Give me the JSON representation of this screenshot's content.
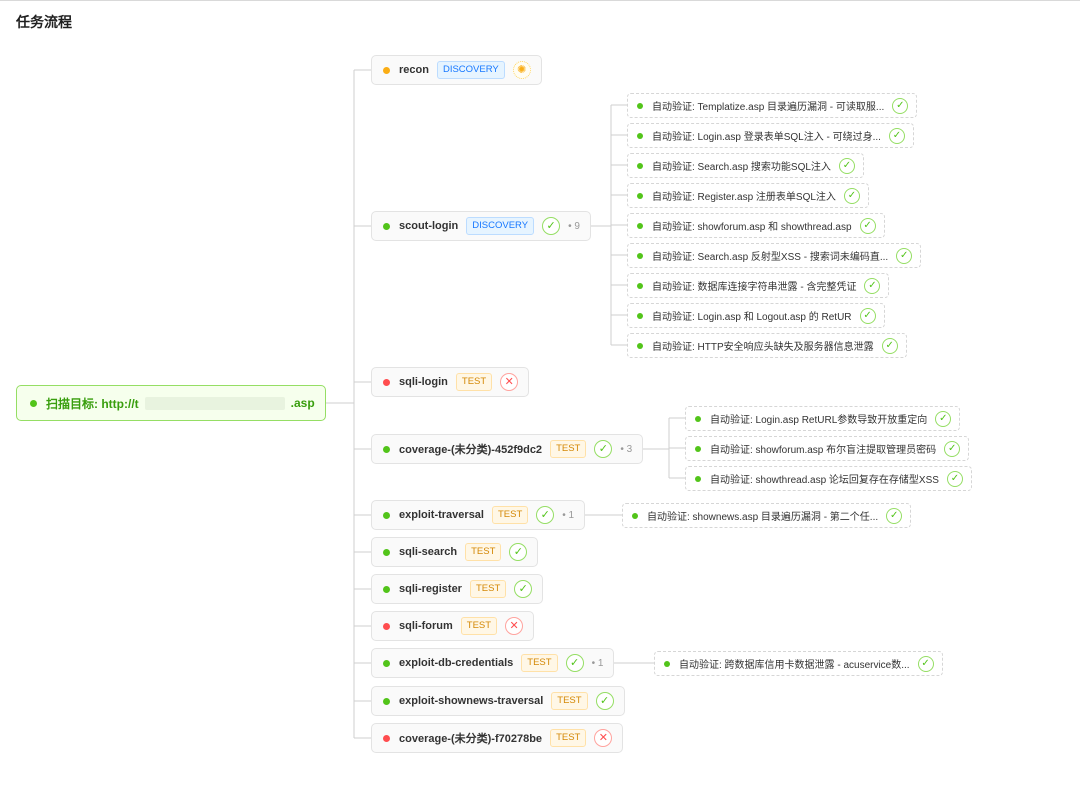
{
  "page": {
    "title": "任务流程"
  },
  "colors": {
    "success": "#52c41a",
    "failed": "#ff4d4f",
    "running": "#faad14",
    "discovery_tag": "#1677ff",
    "test_tag": "#d48806",
    "root_text": "#389e0d"
  },
  "root": {
    "prefix": "扫描目标: http://t",
    "suffix": ".asp",
    "status": "success"
  },
  "tasks": [
    {
      "name": "recon",
      "tag": "DISCOVERY",
      "status": "running",
      "status_icon": "loading-icon",
      "count": ""
    },
    {
      "name": "scout-login",
      "tag": "DISCOVERY",
      "status": "success",
      "status_icon": "check-icon",
      "count": "9"
    },
    {
      "name": "sqli-login",
      "tag": "TEST",
      "status": "failed",
      "status_icon": "close-icon",
      "count": ""
    },
    {
      "name": "coverage-(未分类)-452f9dc2",
      "tag": "TEST",
      "status": "success",
      "status_icon": "check-icon",
      "count": "3"
    },
    {
      "name": "exploit-traversal",
      "tag": "TEST",
      "status": "success",
      "status_icon": "check-icon",
      "count": "1"
    },
    {
      "name": "sqli-search",
      "tag": "TEST",
      "status": "success",
      "status_icon": "check-icon",
      "count": ""
    },
    {
      "name": "sqli-register",
      "tag": "TEST",
      "status": "success",
      "status_icon": "check-icon",
      "count": ""
    },
    {
      "name": "sqli-forum",
      "tag": "TEST",
      "status": "failed",
      "status_icon": "close-icon",
      "count": ""
    },
    {
      "name": "exploit-db-credentials",
      "tag": "TEST",
      "status": "success",
      "status_icon": "check-icon",
      "count": "1"
    },
    {
      "name": "exploit-shownews-traversal",
      "tag": "TEST",
      "status": "success",
      "status_icon": "check-icon",
      "count": ""
    },
    {
      "name": "coverage-(未分类)-f70278be",
      "tag": "TEST",
      "status": "failed",
      "status_icon": "close-icon",
      "count": ""
    }
  ],
  "subtasks": {
    "scout-login": [
      "自动验证: Templatize.asp 目录遍历漏洞 - 可读取服...",
      "自动验证: Login.asp 登录表单SQL注入 - 可绕过身...",
      "自动验证: Search.asp 搜索功能SQL注入",
      "自动验证: Register.asp 注册表单SQL注入",
      "自动验证: showforum.asp 和 showthread.asp",
      "自动验证: Search.asp 反射型XSS - 搜索词未编码直...",
      "自动验证: 数据库连接字符串泄露 - 含完整凭证",
      "自动验证: Login.asp 和 Logout.asp 的 RetUR",
      "自动验证: HTTP安全响应头缺失及服务器信息泄露"
    ],
    "coverage-452f9dc2": [
      "自动验证: Login.asp RetURL参数导致开放重定向",
      "自动验证: showforum.asp 布尔盲注提取管理员密码",
      "自动验证: showthread.asp 论坛回复存在存储型XSS"
    ],
    "exploit-traversal": [
      "自动验证: shownews.asp 目录遍历漏洞 - 第二个任..."
    ],
    "exploit-db-credentials": [
      "自动验证: 跨数据库信用卡数据泄露 - acuservice数..."
    ]
  }
}
